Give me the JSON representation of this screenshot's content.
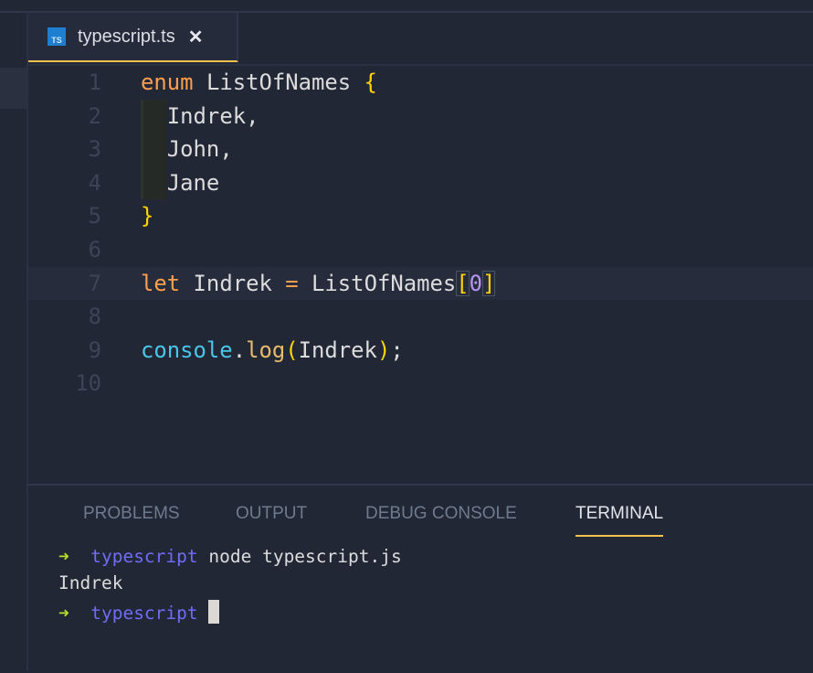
{
  "tab": {
    "icon": "typescript-file-icon",
    "icon_text": "TS",
    "label": "typescript.ts",
    "close": "✕"
  },
  "editor": {
    "lines": [
      {
        "n": "1"
      },
      {
        "n": "2"
      },
      {
        "n": "3"
      },
      {
        "n": "4"
      },
      {
        "n": "5"
      },
      {
        "n": "6"
      },
      {
        "n": "7"
      },
      {
        "n": "8"
      },
      {
        "n": "9"
      },
      {
        "n": "10"
      }
    ],
    "tokens": {
      "enum": "enum",
      "enum_name": "ListOfNames",
      "lbrace": "{",
      "m1": "Indrek,",
      "m2": "John,",
      "m3": "Jane",
      "rbrace": "}",
      "let": "let",
      "var": "Indrek",
      "eq": "=",
      "ref": "ListOfNames",
      "lbr": "[",
      "zero": "0",
      "rbr": "]",
      "console": "console",
      "dot": ".",
      "log": "log",
      "lp": "(",
      "arg": "Indrek",
      "rp": ")",
      "semi": ";"
    }
  },
  "panel": {
    "tabs": [
      {
        "label": "PROBLEMS"
      },
      {
        "label": "OUTPUT"
      },
      {
        "label": "DEBUG CONSOLE"
      },
      {
        "label": "TERMINAL",
        "active": true
      }
    ],
    "terminal": {
      "arrow": "➜",
      "dir": "typescript",
      "command": "node typescript.js",
      "output": "Indrek"
    }
  },
  "colors": {
    "background": "#222736",
    "accent": "#f2c14e",
    "keyword": "#fd9f4d",
    "bracket": "#ffd400",
    "prompt_arrow": "#b5e02b",
    "prompt_dir": "#6f6cf5"
  }
}
